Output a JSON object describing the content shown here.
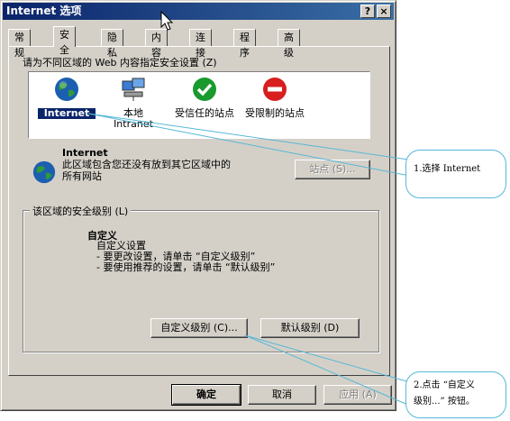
{
  "window": {
    "title": "Internet 选项",
    "help_btn": "?",
    "close_btn": "×"
  },
  "tabs": [
    {
      "label": "常规",
      "active": false
    },
    {
      "label": "安全",
      "active": true
    },
    {
      "label": "隐私",
      "active": false
    },
    {
      "label": "内容",
      "active": false
    },
    {
      "label": "连接",
      "active": false
    },
    {
      "label": "程序",
      "active": false
    },
    {
      "label": "高级",
      "active": false
    }
  ],
  "zones_prompt": "请为不同区域的 Web 内容指定安全设置 (Z)",
  "zones": [
    {
      "label": "Internet",
      "icon": "globe-icon"
    },
    {
      "label": "本地 Intranet",
      "icon": "intranet-icon"
    },
    {
      "label": "受信任的站点",
      "icon": "trusted-check-icon"
    },
    {
      "label": "受限制的站点",
      "icon": "restricted-icon"
    }
  ],
  "zone_info": {
    "name": "Internet",
    "description": "此区域包含您还没有放到其它区域中的所有网站",
    "sites_button": "站点 (S)..."
  },
  "security_level": {
    "group_label": "该区域的安全级别 (L)",
    "title": "自定义",
    "lines": [
      "自定义设置",
      "- 要更改设置，请单击 “自定义级别”",
      "- 要使用推荐的设置，请单击 “默认级别”"
    ],
    "custom_button": "自定义级别 (C)...",
    "default_button": "默认级别 (D)"
  },
  "footer": {
    "ok": "确定",
    "cancel": "取消",
    "apply": "应用 (A)"
  },
  "callouts": {
    "one": "1.选择 Internet",
    "two_a": "2.点击 “自定义",
    "two_b": "级别...” 按钮。"
  },
  "colors": {
    "title_start": "#0a246a",
    "title_end": "#3a6ea5",
    "face": "#d4d0c8",
    "callout_line": "#56b8d6"
  }
}
